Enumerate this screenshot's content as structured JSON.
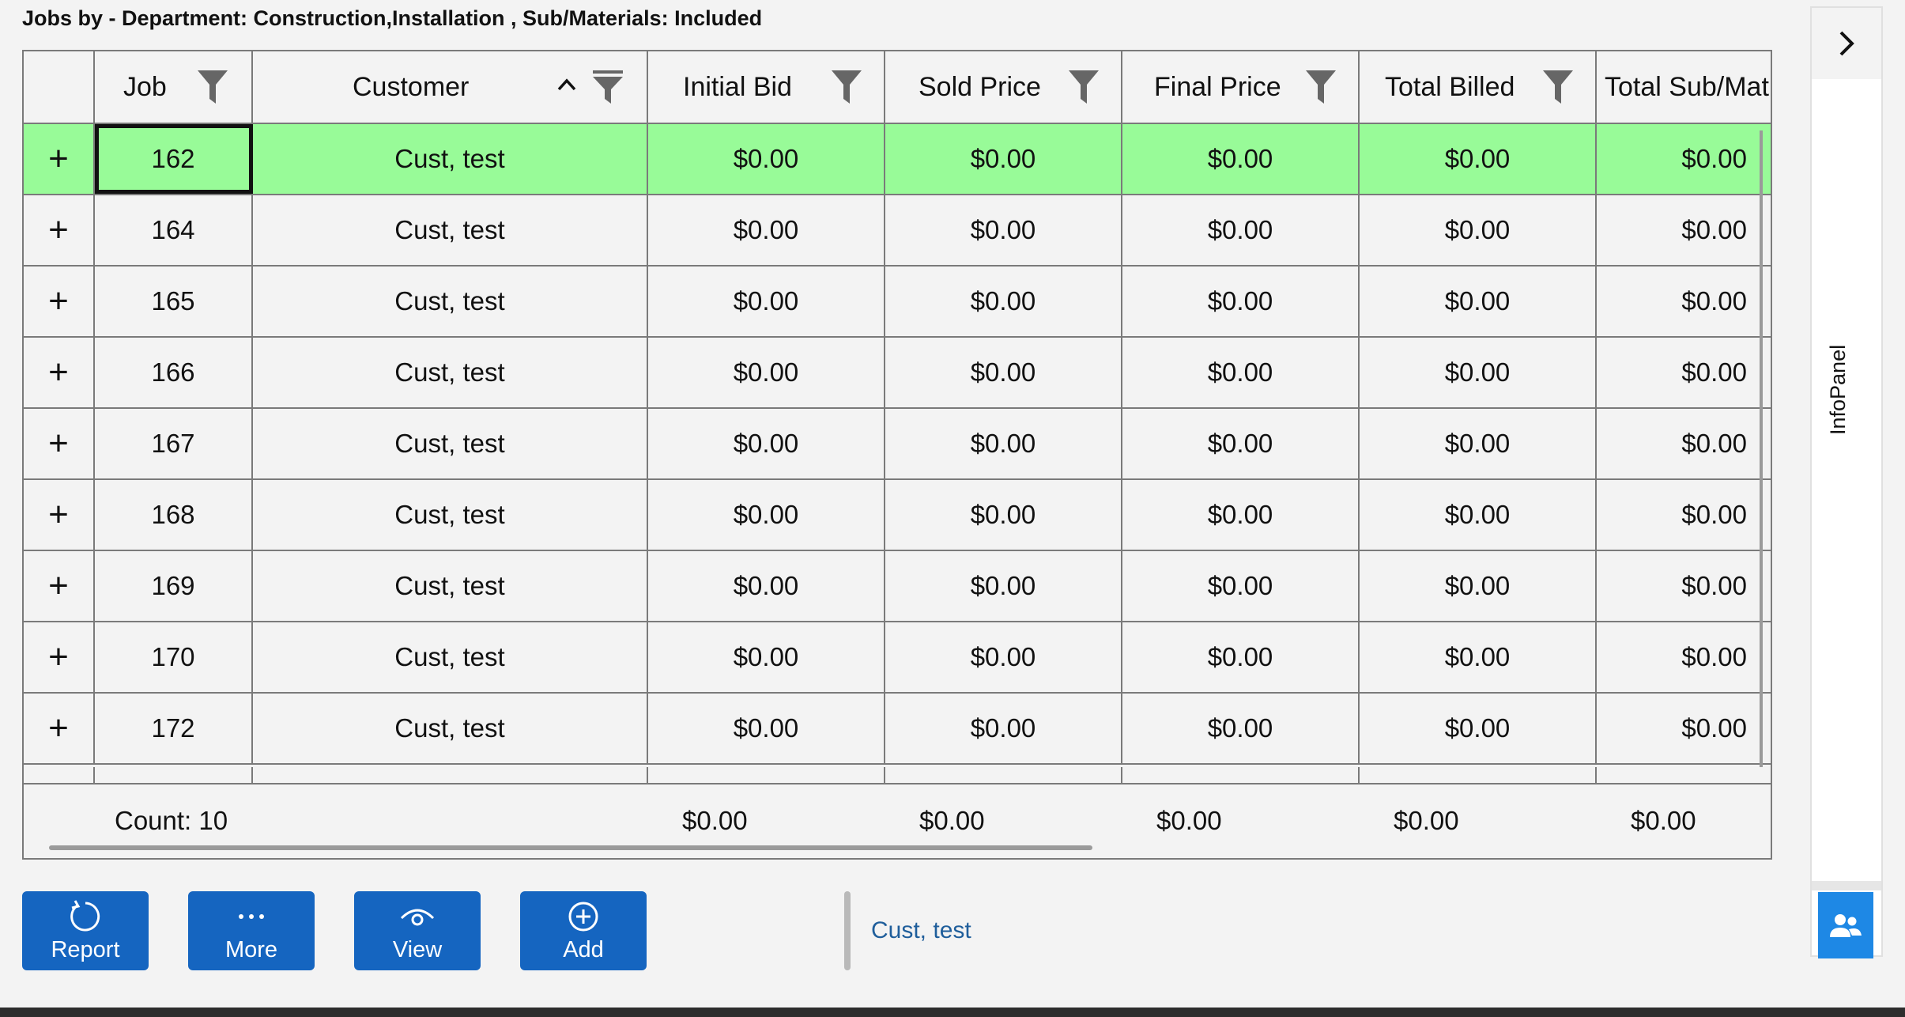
{
  "title": "Jobs by - Department: Construction,Installation , Sub/Materials: Included",
  "columns": [
    {
      "label": ""
    },
    {
      "label": "Job"
    },
    {
      "label": "Customer"
    },
    {
      "label": "Initial Bid"
    },
    {
      "label": "Sold Price"
    },
    {
      "label": "Final Price"
    },
    {
      "label": "Total Billed"
    },
    {
      "label": "Total Sub/Mat"
    }
  ],
  "rows": [
    {
      "expand": "+",
      "job": "162",
      "customer": "Cust, test",
      "initial_bid": "$0.00",
      "sold_price": "$0.00",
      "final_price": "$0.00",
      "total_billed": "$0.00",
      "total_sub": "$0.00"
    },
    {
      "expand": "+",
      "job": "164",
      "customer": "Cust, test",
      "initial_bid": "$0.00",
      "sold_price": "$0.00",
      "final_price": "$0.00",
      "total_billed": "$0.00",
      "total_sub": "$0.00"
    },
    {
      "expand": "+",
      "job": "165",
      "customer": "Cust, test",
      "initial_bid": "$0.00",
      "sold_price": "$0.00",
      "final_price": "$0.00",
      "total_billed": "$0.00",
      "total_sub": "$0.00"
    },
    {
      "expand": "+",
      "job": "166",
      "customer": "Cust, test",
      "initial_bid": "$0.00",
      "sold_price": "$0.00",
      "final_price": "$0.00",
      "total_billed": "$0.00",
      "total_sub": "$0.00"
    },
    {
      "expand": "+",
      "job": "167",
      "customer": "Cust, test",
      "initial_bid": "$0.00",
      "sold_price": "$0.00",
      "final_price": "$0.00",
      "total_billed": "$0.00",
      "total_sub": "$0.00"
    },
    {
      "expand": "+",
      "job": "168",
      "customer": "Cust, test",
      "initial_bid": "$0.00",
      "sold_price": "$0.00",
      "final_price": "$0.00",
      "total_billed": "$0.00",
      "total_sub": "$0.00"
    },
    {
      "expand": "+",
      "job": "169",
      "customer": "Cust, test",
      "initial_bid": "$0.00",
      "sold_price": "$0.00",
      "final_price": "$0.00",
      "total_billed": "$0.00",
      "total_sub": "$0.00"
    },
    {
      "expand": "+",
      "job": "170",
      "customer": "Cust, test",
      "initial_bid": "$0.00",
      "sold_price": "$0.00",
      "final_price": "$0.00",
      "total_billed": "$0.00",
      "total_sub": "$0.00"
    },
    {
      "expand": "+",
      "job": "172",
      "customer": "Cust, test",
      "initial_bid": "$0.00",
      "sold_price": "$0.00",
      "final_price": "$0.00",
      "total_billed": "$0.00",
      "total_sub": "$0.00"
    }
  ],
  "footer": {
    "count": "Count: 10",
    "initial_bid": "$0.00",
    "sold_price": "$0.00",
    "final_price": "$0.00",
    "total_billed": "$0.00",
    "total_sub": "$0.00"
  },
  "buttons": {
    "report": "Report",
    "more": "More",
    "view": "View",
    "add": "Add"
  },
  "status_text": "Cust, test",
  "info_panel": {
    "label": "InfoPanel",
    "icons": [
      "chevron-right-icon",
      "people-icon"
    ]
  },
  "colors": {
    "selected_row": "#98fb98",
    "button": "#1565c0",
    "panel_button": "#1e88e5",
    "status_text": "#1f5e9b"
  },
  "selected_row_index": 0,
  "sort": {
    "column": "Customer",
    "direction": "ascending"
  }
}
